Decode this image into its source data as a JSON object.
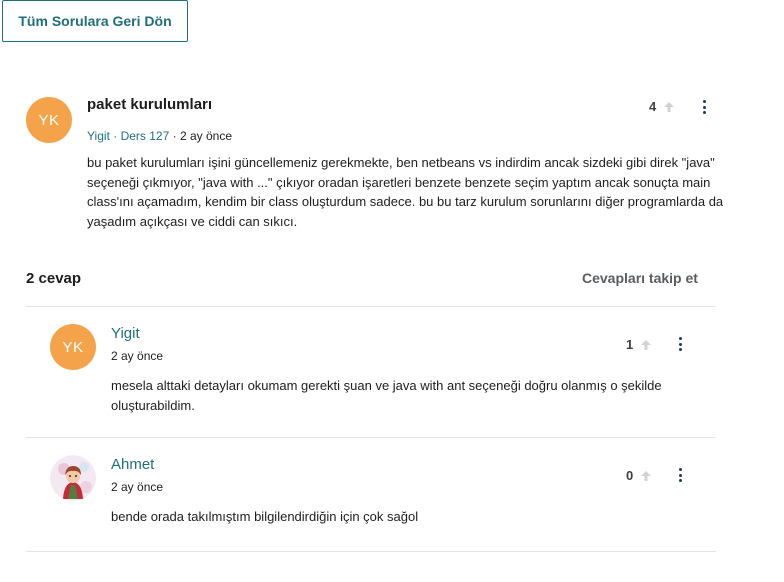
{
  "back_button": {
    "label": "Tüm Sorulara Geri Dön"
  },
  "question": {
    "avatar_initials": "YK",
    "title": "paket kurulumları",
    "author": "Yigit",
    "separator1": " · ",
    "lecture": "Ders 127",
    "separator2": " · ",
    "time": "2 ay önce",
    "body": "bu paket kurulumları işini güncellemeniz gerekmekte, ben netbeans vs indirdim ancak sizdeki gibi direk \"java\" seçeneği çıkmıyor, \"java with ...\" çıkıyor oradan işaretleri benzete benzete seçim yaptım ancak sonuçta main class'ını açamadım, kendim bir class oluşturdum sadece. bu bu tarz kurulum sorunlarını diğer programlarda da yaşadım açıkçası ve ciddi can sıkıcı.",
    "votes": "4"
  },
  "answers_header": {
    "count_label": "2 cevap",
    "follow_label": "Cevapları takip et"
  },
  "answers": [
    {
      "avatar_initials": "YK",
      "name": "Yigit",
      "time": "2 ay önce",
      "body": "mesela alttaki detayları okumam gerekti şuan ve java with ant seçeneği doğru olanmış o şekilde oluşturabildim.",
      "votes": "1"
    },
    {
      "name": "Ahmet",
      "time": "2 ay önce",
      "body": "bende orada takılmıştım bilgilendirdiğin için çok sağol",
      "votes": "0"
    }
  ],
  "colors": {
    "accent": "#1f6f7a",
    "avatar_bg": "#f5a34a",
    "divider": "#e4e4e4"
  }
}
